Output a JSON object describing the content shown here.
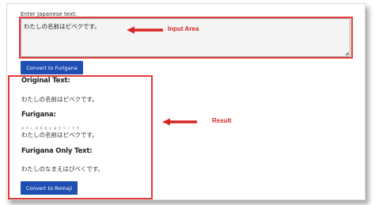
{
  "form": {
    "input_label": "Enter Japanese text:",
    "input_value": "わたしの名前はピベクです。",
    "convert_furigana_label": "Convert to Furigana",
    "convert_romaji_label": "Convert to Romaji"
  },
  "results": {
    "original_heading": "Original Text:",
    "original_text": "わたしの名前はピベクです。",
    "furigana_heading": "Furigana:",
    "furigana_ruby": "わ た し の  な ま え  は ぴ べ く で す",
    "furigana_base": "わたしの名前はピベクです。",
    "furigana_only_heading": "Furigana Only Text:",
    "furigana_only_text": "わたしのなまえはぴべくです。"
  },
  "annotations": {
    "input_area": "Input Area",
    "result": "Result",
    "color": "#d92424"
  },
  "colors": {
    "button": "#1f4fb2",
    "highlight": "#e03b3b"
  }
}
